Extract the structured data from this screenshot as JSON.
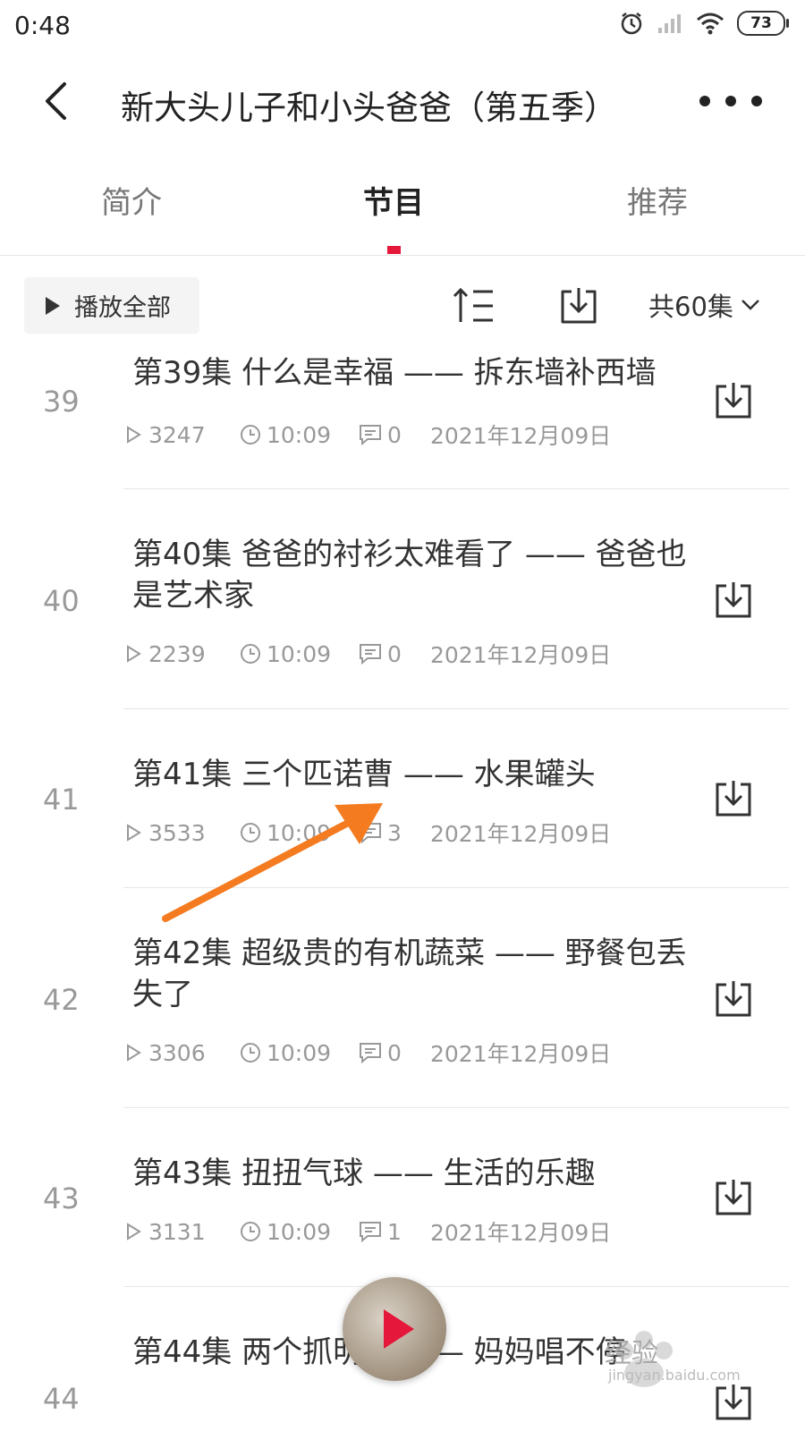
{
  "status_bar": {
    "time": "0:48",
    "battery": "73"
  },
  "header": {
    "title": "新大头儿子和小头爸爸（第五季）"
  },
  "tabs": [
    {
      "label": "简介",
      "active": false
    },
    {
      "label": "节目",
      "active": true
    },
    {
      "label": "推荐",
      "active": false
    }
  ],
  "toolbar": {
    "play_all_label": "播放全部",
    "episode_count_label": "共60集"
  },
  "episodes": [
    {
      "num": "39",
      "title": "第39集 什么是幸福 —— 拆东墙补西墙",
      "plays": "3247",
      "duration": "10:09",
      "comments": "0",
      "date": "2021年12月09日"
    },
    {
      "num": "40",
      "title": "第40集 爸爸的衬衫太难看了 —— 爸爸也是艺术家",
      "plays": "2239",
      "duration": "10:09",
      "comments": "0",
      "date": "2021年12月09日"
    },
    {
      "num": "41",
      "title": "第41集 三个匹诺曹 —— 水果罐头",
      "plays": "3533",
      "duration": "10:09",
      "comments": "3",
      "date": "2021年12月09日"
    },
    {
      "num": "42",
      "title": "第42集 超级贵的有机蔬菜 —— 野餐包丢失了",
      "plays": "3306",
      "duration": "10:09",
      "comments": "0",
      "date": "2021年12月09日"
    },
    {
      "num": "43",
      "title": "第43集 扭扭气球 —— 生活的乐趣",
      "plays": "3131",
      "duration": "10:09",
      "comments": "1",
      "date": "2021年12月09日"
    },
    {
      "num": "44",
      "title": "第44集 两个抓明星 —— 妈妈唱不停",
      "plays": "",
      "duration": "",
      "comments": "",
      "date": ""
    }
  ],
  "watermark": {
    "text": "经验",
    "url": "jingyan.baidu.com"
  },
  "colors": {
    "accent": "#e5173a",
    "annotation_arrow": "#f47b20"
  }
}
